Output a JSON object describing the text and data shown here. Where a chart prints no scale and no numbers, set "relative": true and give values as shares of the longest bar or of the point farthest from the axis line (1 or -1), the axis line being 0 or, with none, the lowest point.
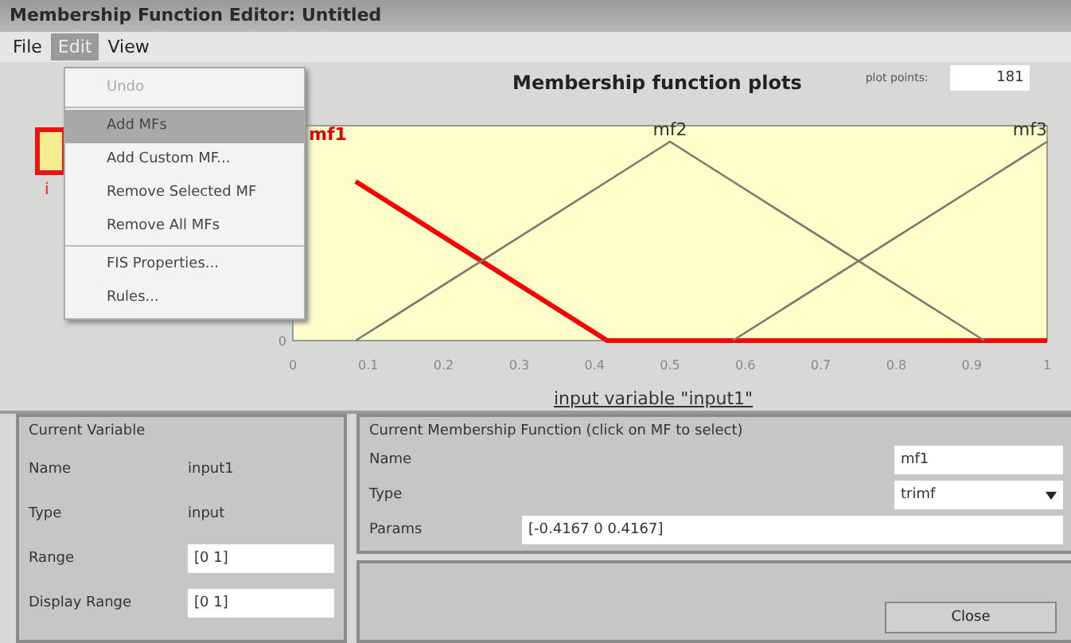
{
  "window": {
    "title": "Membership Function Editor: Untitled"
  },
  "menubar": [
    {
      "label": "File",
      "selected": false
    },
    {
      "label": "Edit",
      "selected": true
    },
    {
      "label": "View",
      "selected": false
    }
  ],
  "edit_menu": {
    "groups": [
      [
        {
          "label": "Undo",
          "disabled": true,
          "selected": false
        }
      ],
      [
        {
          "label": "Add MFs",
          "disabled": false,
          "selected": true
        },
        {
          "label": "Add Custom MF...",
          "disabled": false,
          "selected": false
        },
        {
          "label": "Remove Selected MF",
          "disabled": false,
          "selected": false
        },
        {
          "label": "Remove All MFs",
          "disabled": false,
          "selected": false
        }
      ],
      [
        {
          "label": "FIS Properties...",
          "disabled": false,
          "selected": false
        },
        {
          "label": "Rules...",
          "disabled": false,
          "selected": false
        }
      ]
    ]
  },
  "fis_variables": {
    "input_label": "i",
    "selected": true
  },
  "plot": {
    "plot_points_label": "plot points:",
    "plot_points": "181",
    "chart_data": {
      "type": "line",
      "title": "Membership function plots",
      "xlabel": "input variable \"input1\"",
      "x": [
        0.0833,
        0.4167,
        0.5,
        0.5833,
        0.9167,
        1
      ],
      "series": [
        {
          "name": "mf1",
          "color": "#ff0000",
          "values": [
            0.8,
            0,
            0,
            0,
            0,
            0
          ]
        },
        {
          "name": "mf2",
          "color": "#7a7a6a",
          "values": [
            0,
            0.8,
            1,
            0.8,
            0,
            null
          ]
        },
        {
          "name": "mf3",
          "color": "#7a7a6a",
          "values": [
            null,
            null,
            null,
            0,
            0.8,
            1
          ]
        }
      ],
      "relative": true,
      "xlim": [
        0,
        1
      ],
      "xticks": [
        0,
        0.1,
        0.2,
        0.3,
        0.4,
        0.5,
        0.6,
        0.7,
        0.8,
        0.9,
        1
      ]
    },
    "y_axis_label": "0"
  },
  "current_variable": {
    "title": "Current Variable",
    "rows": [
      {
        "kind": "text",
        "label": "Name",
        "value": "input1"
      },
      {
        "kind": "text",
        "label": "Type",
        "value": "input"
      },
      {
        "kind": "field",
        "label": "Range",
        "value": "[0 1]"
      },
      {
        "kind": "field",
        "label": "Display Range",
        "value": "[0 1]"
      }
    ]
  },
  "current_mf": {
    "title": "Current Membership Function (click on MF to select)",
    "name_label": "Name",
    "name": "mf1",
    "type_label": "Type",
    "type": "trimf",
    "params_label": "Params",
    "params": "[-0.4167 0 0.4167]"
  },
  "buttons": [
    {
      "label": "Close"
    }
  ]
}
